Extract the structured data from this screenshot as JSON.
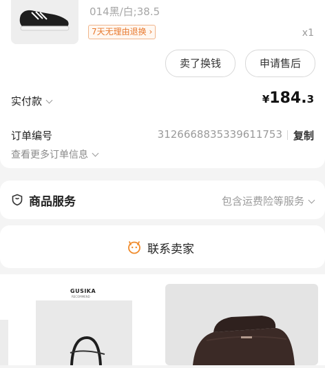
{
  "product": {
    "spec": "014黑/白;38.5",
    "tag": "7天无理由退换",
    "tag_arrow": "›",
    "qty": "x1"
  },
  "actions": {
    "sell": "卖了换钱",
    "after_sale": "申请售后"
  },
  "payment": {
    "label": "实付款",
    "currency": "¥",
    "amount_main": "184.",
    "amount_decimal": "3"
  },
  "order": {
    "number_label": "订单编号",
    "number_value": "3126668835339611753",
    "copy": "复制",
    "more": "查看更多订单信息"
  },
  "service": {
    "title": "商品服务",
    "detail": "包含运费险等服务"
  },
  "contact": {
    "label": "联系卖家"
  },
  "recommend": {
    "brand": "GUSIKA",
    "brand_sub": "RECOMMEND"
  }
}
